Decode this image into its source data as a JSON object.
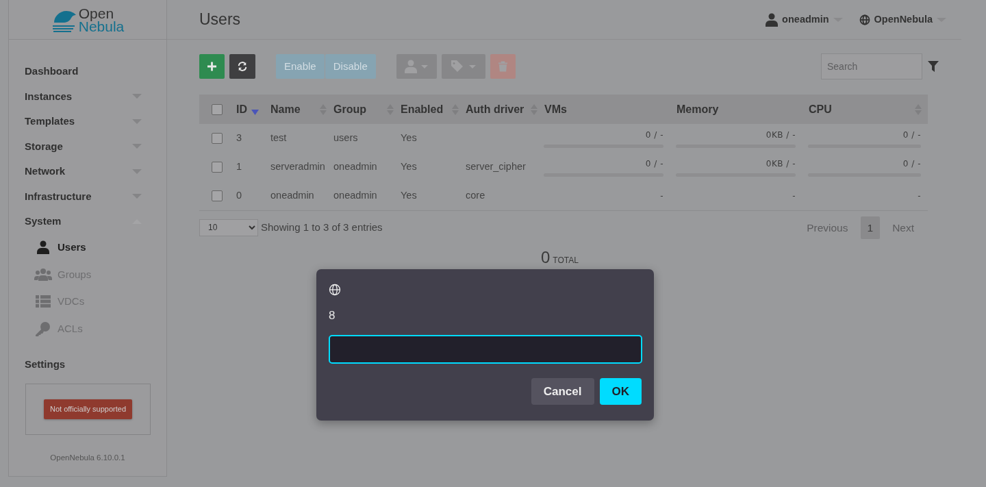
{
  "sidebar": {
    "logo": {
      "line1": "Open",
      "line2": "Nebula"
    },
    "items": [
      {
        "label": "Dashboard"
      },
      {
        "label": "Instances",
        "expanded": false
      },
      {
        "label": "Templates",
        "expanded": false
      },
      {
        "label": "Storage",
        "expanded": false
      },
      {
        "label": "Network",
        "expanded": false
      },
      {
        "label": "Infrastructure",
        "expanded": false
      },
      {
        "label": "System",
        "expanded": true,
        "children": [
          {
            "label": "Users",
            "kind": "user",
            "selected": true
          },
          {
            "label": "Groups",
            "kind": "group",
            "selected": false
          },
          {
            "label": "VDCs",
            "kind": "list",
            "selected": false
          },
          {
            "label": "ACLs",
            "kind": "key",
            "selected": false
          }
        ]
      },
      {
        "label": "Settings"
      }
    ],
    "support_badge": "Not officially supported",
    "version": "OpenNebula 6.10.0.1"
  },
  "header": {
    "title": "Users",
    "user": "oneadmin",
    "zone": "OpenNebula"
  },
  "toolbar": {
    "buttons": [
      {
        "kind": "create",
        "disabled": false
      },
      {
        "kind": "refresh",
        "disabled": false
      },
      {
        "kind": "enable",
        "label": "Enable",
        "disabled": true
      },
      {
        "kind": "enable",
        "label": "Disable",
        "disabled": true
      },
      {
        "kind": "user-menu",
        "disabled": true
      },
      {
        "kind": "tag-menu",
        "disabled": true
      },
      {
        "kind": "delete",
        "disabled": true
      }
    ],
    "search": {
      "placeholder": "Search"
    }
  },
  "table": {
    "select_all": false,
    "columns": [
      {
        "label": "ID",
        "sorted": true
      },
      {
        "label": "Name",
        "sortable": true,
        "sorted": false
      },
      {
        "label": "Group",
        "sortable": true,
        "sorted": false
      },
      {
        "label": "Enabled",
        "sortable": true,
        "sorted": false
      },
      {
        "label": "Auth driver",
        "sortable": true,
        "sorted": false
      },
      {
        "label": "VMs"
      },
      {
        "label": "Memory"
      },
      {
        "label": "CPU",
        "sortable": true,
        "sorted": false
      }
    ],
    "rows": [
      {
        "checked": false,
        "cells": [
          "3",
          "test",
          "users",
          "Yes",
          ""
        ],
        "usage": [
          {
            "reading": "0 / -",
            "level": 0
          },
          {
            "reading": "0KB / -",
            "level": 0
          },
          {
            "reading": "0 / -",
            "level": 0
          }
        ]
      },
      {
        "checked": false,
        "cells": [
          "1",
          "serveradmin",
          "oneadmin",
          "Yes",
          "server_cipher"
        ],
        "usage": [
          {
            "reading": "0 / -",
            "level": 0
          },
          {
            "reading": "0KB / -",
            "level": 0
          },
          {
            "reading": "0 / -",
            "level": 0
          }
        ]
      },
      {
        "checked": false,
        "cells": [
          "0",
          "oneadmin",
          "oneadmin",
          "Yes",
          "core"
        ],
        "usage": [
          {
            "reading": "-"
          },
          {
            "reading": "-"
          },
          {
            "reading": "-"
          }
        ]
      }
    ]
  },
  "footer": {
    "page_size": "10",
    "info": "Showing 1 to 3 of 3 entries",
    "pagination": [
      {
        "label": "Previous",
        "selected": false
      },
      {
        "label": "1",
        "selected": true
      },
      {
        "label": "Next",
        "selected": false
      }
    ]
  },
  "total": {
    "value": "0",
    "label": "TOTAL"
  },
  "dialog": {
    "message": "8",
    "buttons": [
      {
        "label": "Cancel",
        "kind": "secondary"
      },
      {
        "label": "OK",
        "kind": "primary"
      }
    ]
  }
}
